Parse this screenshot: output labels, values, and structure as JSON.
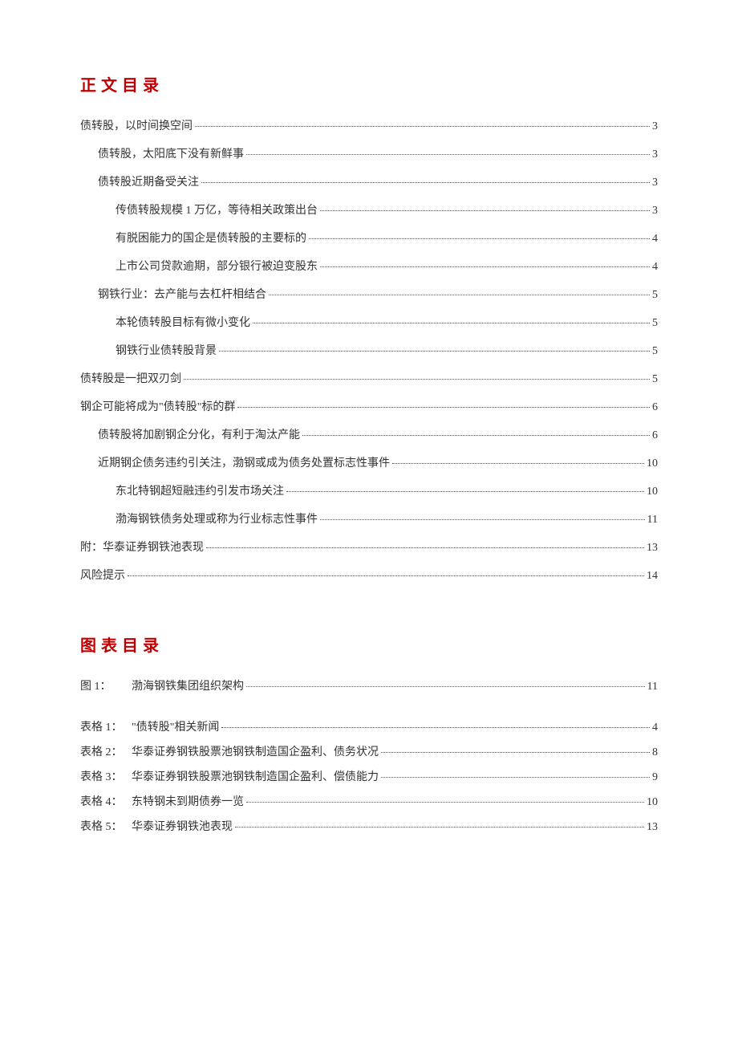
{
  "toc": {
    "title": "正文目录",
    "entries": [
      {
        "label": "债转股，以时间换空间",
        "page": "3",
        "indent": 0
      },
      {
        "label": "债转股，太阳底下没有新鲜事",
        "page": "3",
        "indent": 1
      },
      {
        "label": "债转股近期备受关注",
        "page": "3",
        "indent": 1
      },
      {
        "label": "传债转股规模 1 万亿，等待相关政策出台",
        "page": "3",
        "indent": 2
      },
      {
        "label": "有脱困能力的国企是债转股的主要标的",
        "page": "4",
        "indent": 2
      },
      {
        "label": "上市公司贷款逾期，部分银行被迫变股东",
        "page": "4",
        "indent": 2
      },
      {
        "label": "钢铁行业：去产能与去杠杆相结合",
        "page": "5",
        "indent": 1
      },
      {
        "label": "本轮债转股目标有微小变化",
        "page": "5",
        "indent": 2
      },
      {
        "label": "钢铁行业债转股背景",
        "page": "5",
        "indent": 2
      },
      {
        "label": "债转股是一把双刃剑",
        "page": "5",
        "indent": 0
      },
      {
        "label": "钢企可能将成为\"债转股\"标的群",
        "page": "6",
        "indent": 0
      },
      {
        "label": "债转股将加剧钢企分化，有利于淘汰产能",
        "page": "6",
        "indent": 1
      },
      {
        "label": "近期钢企债务违约引关注，渤钢或成为债务处置标志性事件",
        "page": "10",
        "indent": 1
      },
      {
        "label": "东北特钢超短融违约引发市场关注",
        "page": "10",
        "indent": 2
      },
      {
        "label": "渤海钢铁债务处理或称为行业标志性事件",
        "page": "11",
        "indent": 2
      },
      {
        "label": "附：华泰证券钢铁池表现",
        "page": "13",
        "indent": 0
      },
      {
        "label": "风险提示",
        "page": "14",
        "indent": 0
      }
    ]
  },
  "figtab": {
    "title": "图表目录",
    "figures": [
      {
        "prefix": "图 1：",
        "title": "渤海钢铁集团组织架构",
        "page": "11"
      }
    ],
    "tables": [
      {
        "prefix": "表格 1：",
        "title": "\"债转股\"相关新闻",
        "page": "4"
      },
      {
        "prefix": "表格 2：",
        "title": "华泰证券钢铁股票池钢铁制造国企盈利、债务状况",
        "page": "8"
      },
      {
        "prefix": "表格 3：",
        "title": "华泰证券钢铁股票池钢铁制造国企盈利、偿债能力",
        "page": "9"
      },
      {
        "prefix": "表格 4：",
        "title": "东特钢未到期债券一览",
        "page": "10"
      },
      {
        "prefix": "表格 5：",
        "title": "华泰证券钢铁池表现",
        "page": "13"
      }
    ]
  }
}
